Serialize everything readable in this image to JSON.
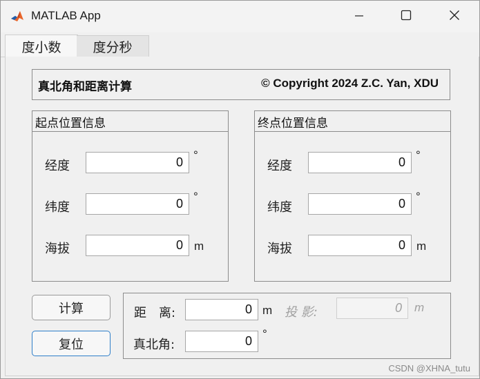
{
  "window": {
    "title": "MATLAB App",
    "icons": {
      "app": "matlab-logo-icon",
      "minimize": "minimize-icon",
      "maximize": "maximize-icon",
      "close": "close-icon"
    }
  },
  "tabs": [
    {
      "label": "度小数",
      "active": true
    },
    {
      "label": "度分秒",
      "active": false
    }
  ],
  "header": {
    "title": "真北角和距离计算",
    "copyright": "© Copyright 2024 Z.C. Yan, XDU"
  },
  "start_panel": {
    "title": "起点位置信息",
    "longitude_label": "经度",
    "longitude_value": "0",
    "longitude_unit": "°",
    "latitude_label": "纬度",
    "latitude_value": "0",
    "latitude_unit": "°",
    "altitude_label": "海拔",
    "altitude_value": "0",
    "altitude_unit": "m"
  },
  "end_panel": {
    "title": "终点位置信息",
    "longitude_label": "经度",
    "longitude_value": "0",
    "longitude_unit": "°",
    "latitude_label": "纬度",
    "latitude_value": "0",
    "latitude_unit": "°",
    "altitude_label": "海拔",
    "altitude_value": "0",
    "altitude_unit": "m"
  },
  "buttons": {
    "calculate": "计算",
    "reset": "复位"
  },
  "results": {
    "distance_label": "距　离:",
    "distance_value": "0",
    "distance_unit": "m",
    "projection_label": "投 影:",
    "projection_value": "0",
    "projection_unit": "m",
    "azimuth_label": "真北角:",
    "azimuth_value": "0",
    "azimuth_unit": "°"
  },
  "watermark": "CSDN @XHNA_tutu",
  "colors": {
    "accent": "#2d7ec9",
    "window_bg": "#f0f0f0",
    "border": "#8c8c8c"
  }
}
